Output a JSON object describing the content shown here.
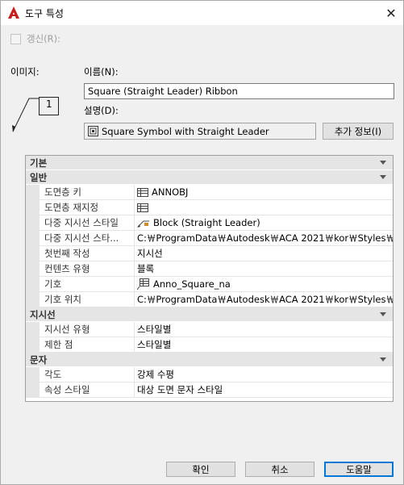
{
  "window": {
    "title": "도구 특성",
    "close_glyph": "✕",
    "accent_color": "#c81c1c"
  },
  "refresh": {
    "label": "갱신(R):",
    "checked": false
  },
  "labels": {
    "image": "이미지:",
    "name": "이름(N):",
    "description": "설명(D):"
  },
  "image_preview": {
    "tag_number": "1"
  },
  "name_value": "Square (Straight Leader) Ribbon",
  "description_value": "Square Symbol with Straight Leader",
  "more_info_button": "추가 정보(I)",
  "grid": {
    "top_category": "기본",
    "categories": [
      {
        "name": "일반",
        "rows": [
          {
            "name": "도면층 키",
            "value": "ANNOBJ",
            "icon": "layer-list-icon"
          },
          {
            "name": "도면층 재지정",
            "value": "",
            "icon": "layer-list-icon"
          },
          {
            "name": "다중 지시선 스타일",
            "value": "Block (Straight Leader)",
            "icon": "mleader-style-icon"
          },
          {
            "name": "다중 지시선 스타...",
            "value": "C:￦ProgramData￦Autodesk￦ACA  2021￦kor￦Styles￦...",
            "icon": ""
          },
          {
            "name": "첫번째 작성",
            "value": "지시선",
            "icon": ""
          },
          {
            "name": "컨텐츠 유형",
            "value": "블록",
            "icon": ""
          },
          {
            "name": "기호",
            "value": "Anno_Square_na",
            "icon": "block-symbol-icon"
          },
          {
            "name": "기호 위치",
            "value": "C:￦ProgramData￦Autodesk￦ACA  2021￦kor￦Styles￦...",
            "icon": ""
          }
        ]
      },
      {
        "name": "지시선",
        "rows": [
          {
            "name": "지시선 유형",
            "value": "스타일별",
            "icon": ""
          },
          {
            "name": "제한 점",
            "value": "스타일별",
            "icon": ""
          }
        ]
      },
      {
        "name": "문자",
        "rows": [
          {
            "name": "각도",
            "value": "강제 수평",
            "icon": ""
          },
          {
            "name": "속성 스타일",
            "value": "대상 도면 문자 스타일",
            "icon": ""
          }
        ]
      }
    ]
  },
  "buttons": {
    "ok": "확인",
    "cancel": "취소",
    "help": "도움말"
  }
}
